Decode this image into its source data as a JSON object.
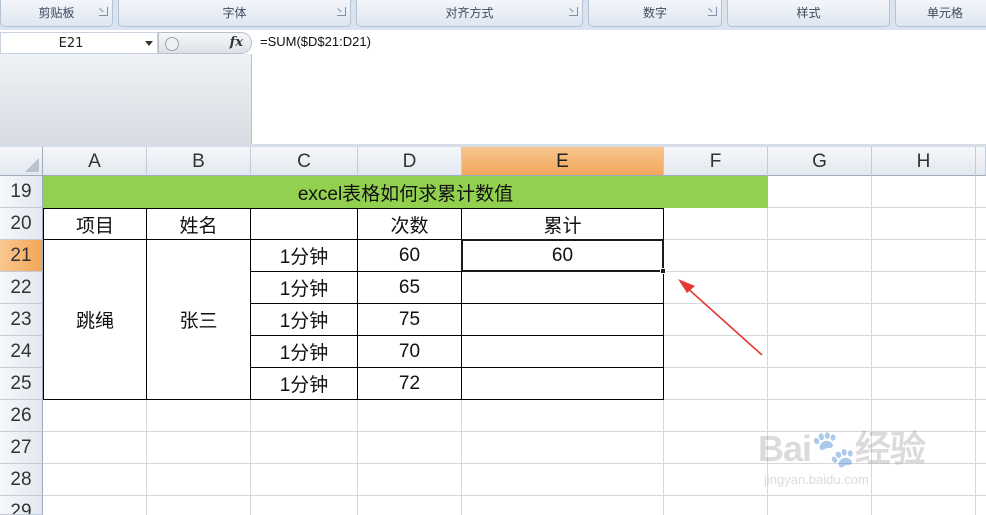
{
  "ribbon": {
    "groups": [
      "剪贴板",
      "字体",
      "对齐方式",
      "数字",
      "样式",
      "单元格"
    ]
  },
  "formula_bar": {
    "name_box": "E21",
    "fx_label": "fx",
    "formula": "=SUM($D$21:D21)"
  },
  "columns": [
    "A",
    "B",
    "C",
    "D",
    "E",
    "F",
    "G",
    "H"
  ],
  "rows": [
    "19",
    "20",
    "21",
    "22",
    "23",
    "24",
    "25",
    "26",
    "27",
    "28",
    "29"
  ],
  "sheet": {
    "title": "excel表格如何求累计数值",
    "headers": {
      "a": "项目",
      "b": "姓名",
      "c": "",
      "d": "次数",
      "e": "累计"
    },
    "a_merged": "跳绳",
    "b_merged": "张三",
    "data_rows": [
      {
        "c": "1分钟",
        "d": "60",
        "e": "60"
      },
      {
        "c": "1分钟",
        "d": "65",
        "e": ""
      },
      {
        "c": "1分钟",
        "d": "75",
        "e": ""
      },
      {
        "c": "1分钟",
        "d": "70",
        "e": ""
      },
      {
        "c": "1分钟",
        "d": "72",
        "e": ""
      }
    ]
  },
  "selection": {
    "cell": "E21"
  },
  "colors": {
    "title_fill": "#92d050",
    "selected_header": "#f2a65a",
    "arrow": "#e53935"
  },
  "watermark": {
    "brand": "Bai",
    "brand2": "经验",
    "url": "jingyan.baidu.com"
  }
}
